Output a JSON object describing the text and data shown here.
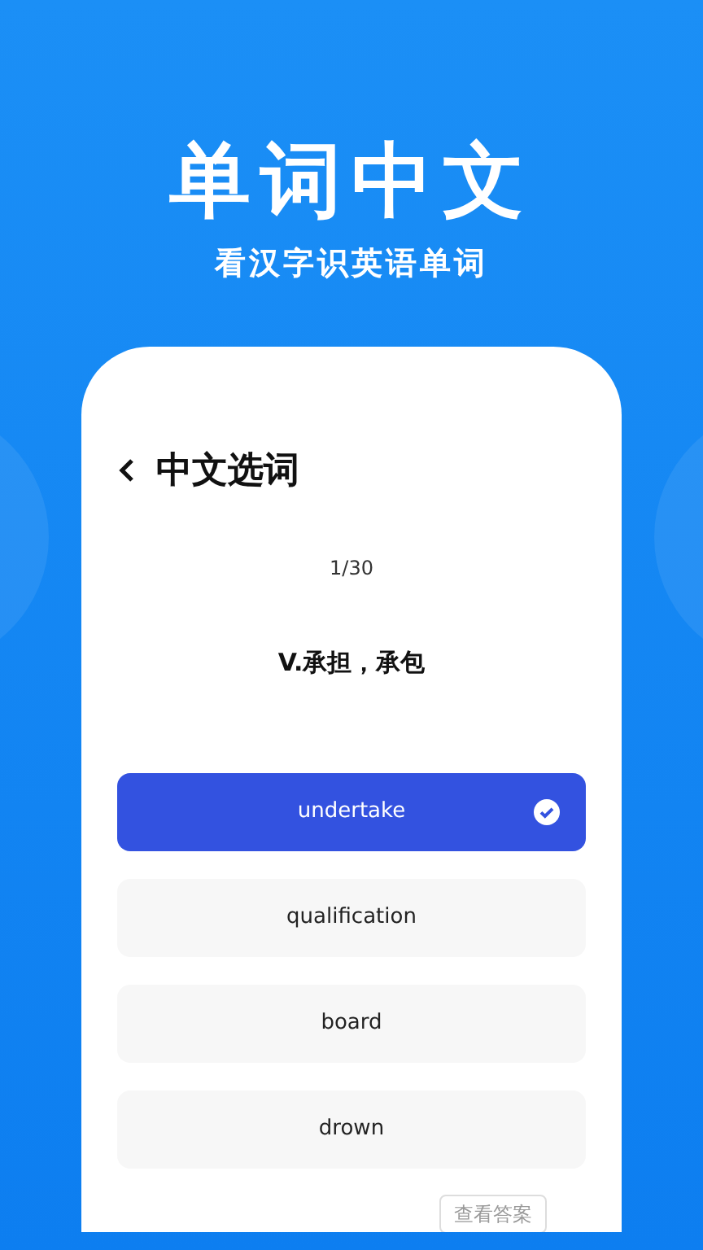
{
  "headline": "单词中文",
  "subtitle": "看汉字识英语单词",
  "screen": {
    "title": "中文选词",
    "progress": "1/30",
    "prompt": "V.承担，承包",
    "options": [
      {
        "label": "undertake",
        "selected": true
      },
      {
        "label": "qualification",
        "selected": false
      },
      {
        "label": "board",
        "selected": false
      },
      {
        "label": "drown",
        "selected": false
      }
    ],
    "answer_button": "查看答案"
  }
}
